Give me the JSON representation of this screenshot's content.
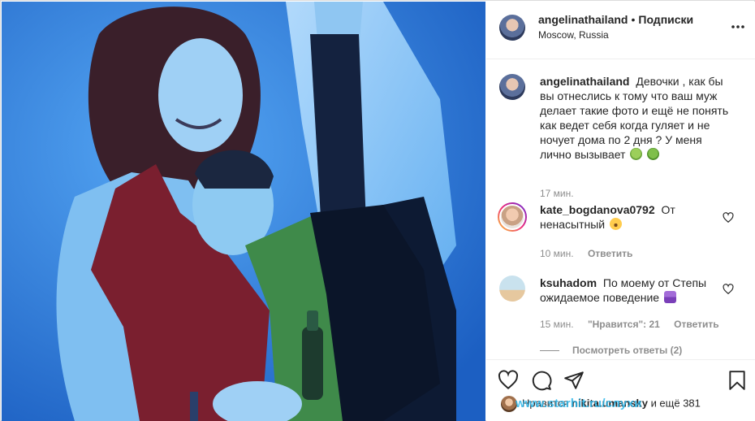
{
  "post": {
    "owner": "angelinathailand",
    "separator": "•",
    "follow_label": "Подписки",
    "location": "Moscow, Russia"
  },
  "caption": {
    "username": "angelinathailand",
    "text": "Девочки , как бы вы отнеслись к тому что ваш муж делает такие фото и ещё не понять как ведет себя когда гуляет и не ночует дома по 2 дня ? У меня лично вызывает",
    "emoji": [
      "nauseated-face",
      "vomiting-face"
    ],
    "time": "17 мин."
  },
  "comments": [
    {
      "username": "kate_bogdanova0792",
      "text": "От ненасытный",
      "emoji": [
        "astonished-face"
      ],
      "time": "10 мин.",
      "reply_label": "Ответить",
      "story_ring": true
    },
    {
      "username": "ksuhadom",
      "text": "По моему от Степы ожидаемое поведение",
      "emoji": [
        "woman-gesturing-no"
      ],
      "time": "15 мин.",
      "likes_label": "\"Нравится\": 21",
      "reply_label": "Ответить",
      "view_replies": "Посмотреть ответы (2)"
    }
  ],
  "likes_line": {
    "prefix": "Нравится",
    "user": "nikita.umansky",
    "rest": "и ещё 381"
  },
  "watermark": "www.starhit.ru/слухи",
  "icons": [
    "more-icon",
    "heart-icon",
    "comment-icon",
    "share-icon",
    "bookmark-icon"
  ],
  "colors": {
    "accent": "#2db7ea",
    "text": "#262626",
    "muted": "#8e8e8e",
    "photo_bg": "#2a86e6",
    "dress": "#7a1f2f"
  }
}
